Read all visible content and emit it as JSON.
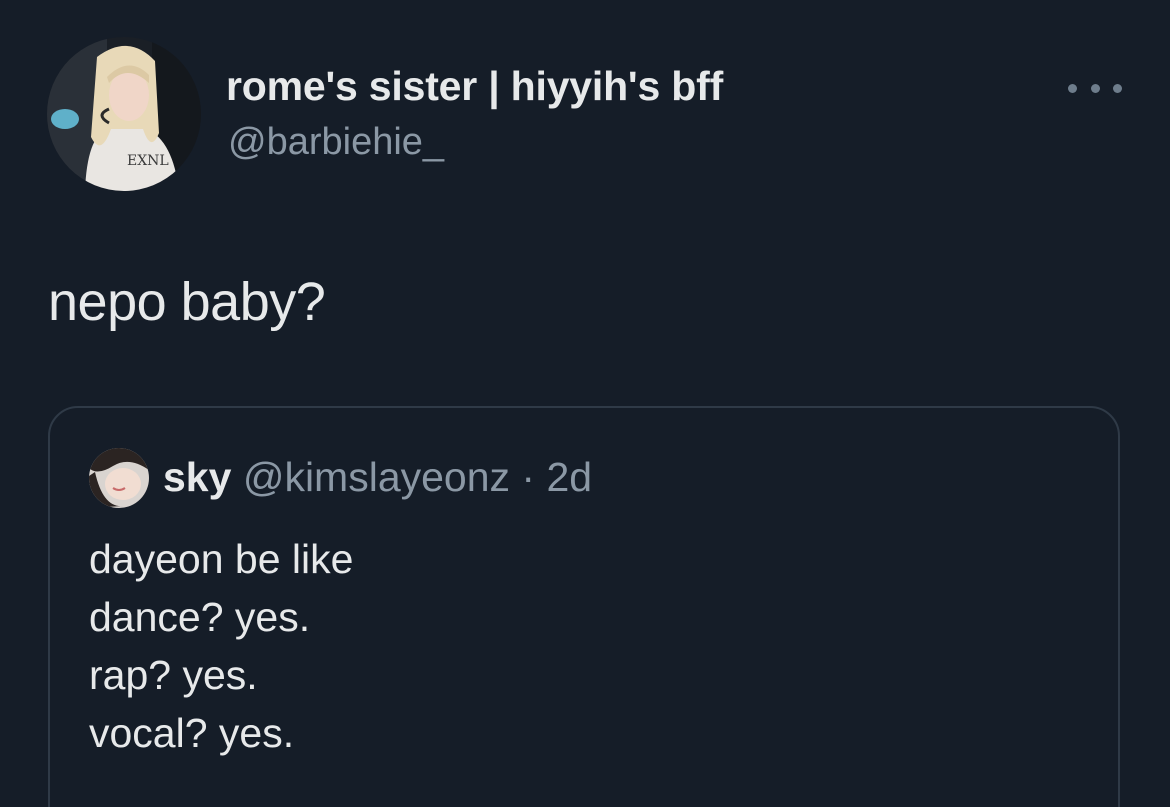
{
  "tweet": {
    "author": {
      "display_name": "rome's sister | hiyyih's bff",
      "handle": "@barbiehie_"
    },
    "more_icon": "more-horizontal-icon",
    "text": "nepo baby?",
    "quote": {
      "author_name": "sky",
      "author_handle": "@kimslayeonz",
      "separator": " · ",
      "time": "2d",
      "lines": [
        "dayeon be like",
        "dance? yes.",
        "rap? yes.",
        "vocal? yes."
      ]
    }
  },
  "colors": {
    "background": "#151d28",
    "primary_text": "#e7e9ea",
    "secondary_text": "#8b98a5",
    "border": "#2f3a47"
  }
}
